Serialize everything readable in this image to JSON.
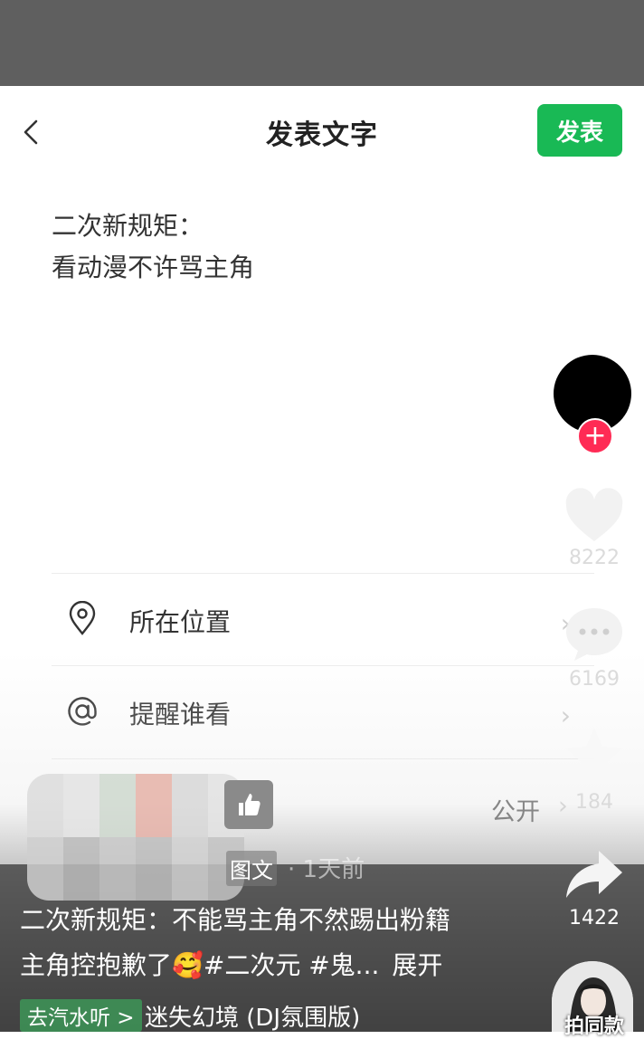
{
  "header": {
    "title": "发表文字",
    "publish_label": "发表"
  },
  "post": {
    "lines": [
      "二次新规矩：",
      "看动漫不许骂主角"
    ]
  },
  "options": [
    {
      "icon": "location-pin-icon",
      "label": "所在位置"
    },
    {
      "icon": "at-sign-icon",
      "label": "提醒谁看"
    }
  ],
  "visibility": {
    "value": "公开"
  },
  "feed": {
    "type_tag": "图文",
    "time": "· 1天前",
    "caption_line1": "二次新规矩：不能骂主角不然踢出粉籍",
    "caption_line2": "主角控抱歉了🥰#二次元 #鬼...",
    "expand_label": "展开",
    "music_tag": "去汽水听 >",
    "music_name": "迷失幻境 (DJ氛围版)"
  },
  "sidebar": {
    "likes": "8222",
    "comments": "6169",
    "favorites": "184",
    "shares": "1422",
    "pai_label": "拍同款",
    "follow_symbol": "+"
  },
  "colors": {
    "brand_green": "#19b955",
    "follow_red": "#ff2b55"
  }
}
